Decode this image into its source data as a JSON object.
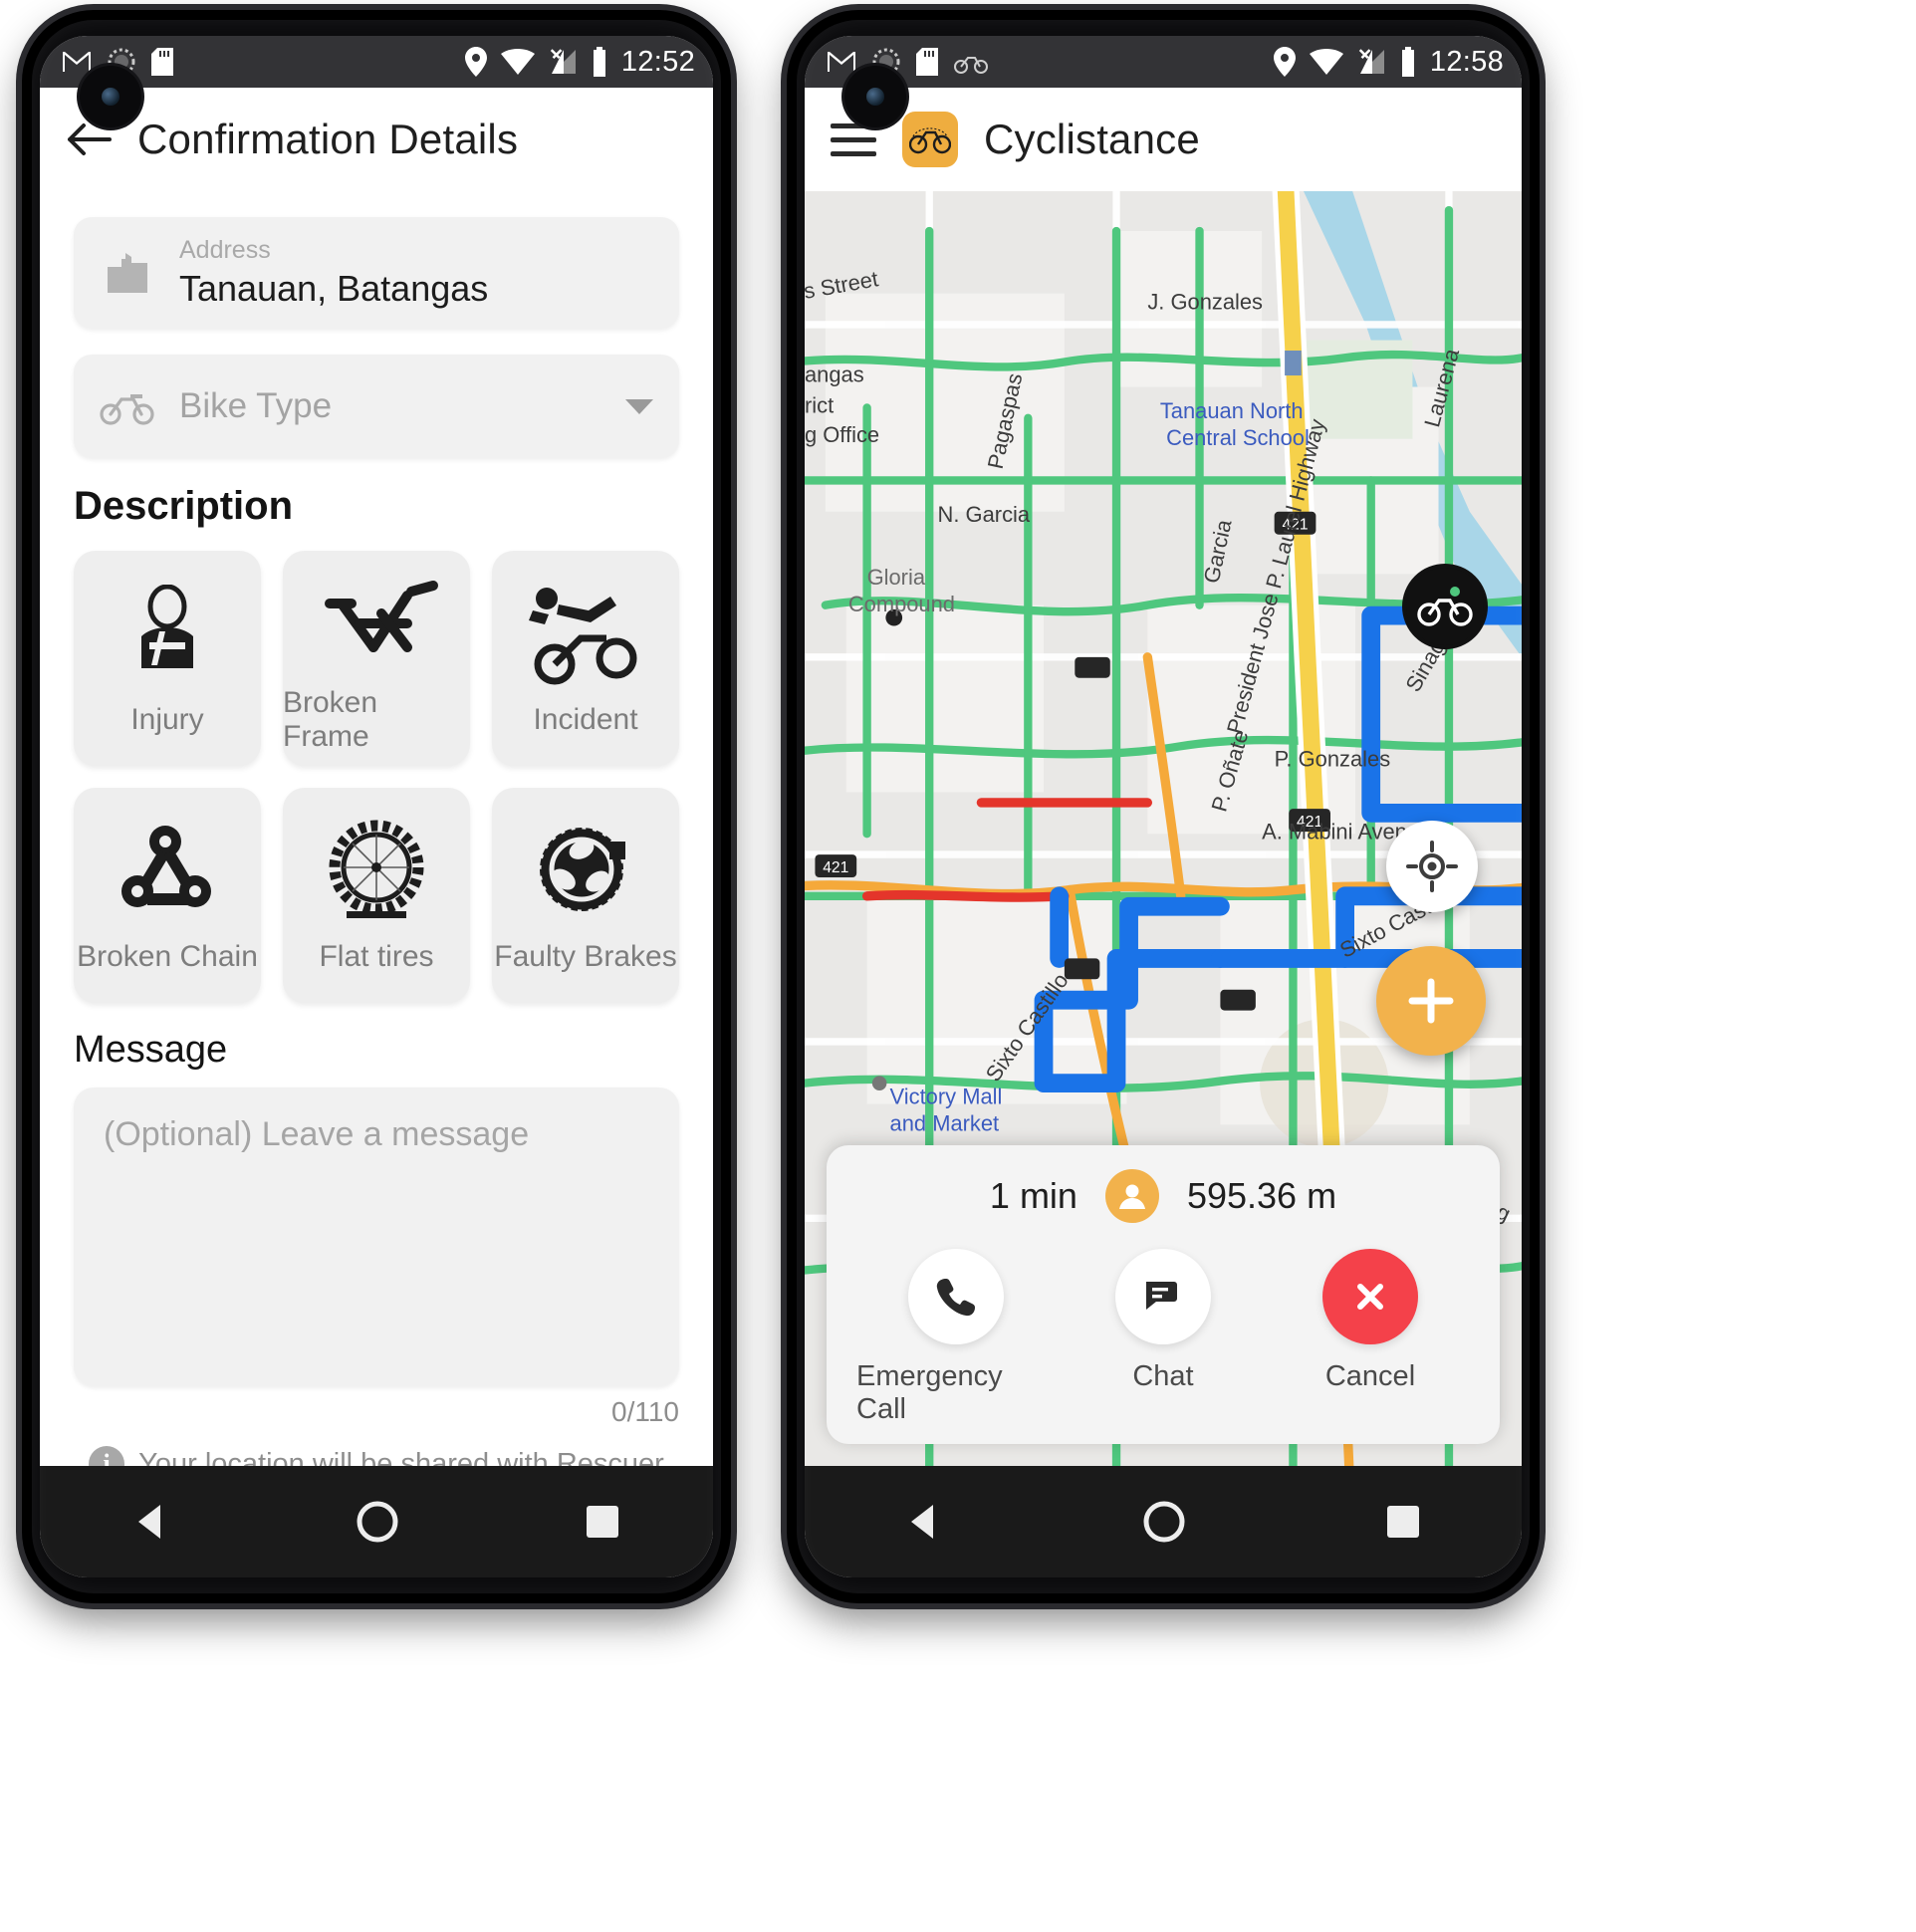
{
  "left_phone": {
    "status_bar": {
      "time": "12:52",
      "icons": [
        "gmail-icon",
        "sync-circle-icon",
        "sd-card-icon"
      ],
      "right_icons": [
        "location-pin-icon",
        "wifi-icon",
        "cell-signal-off-icon",
        "battery-icon"
      ]
    },
    "app_bar": {
      "back_label": "back-arrow",
      "title": "Confirmation Details"
    },
    "address_field": {
      "icon": "building-icon",
      "label": "Address",
      "value": "Tanauan, Batangas"
    },
    "bike_type_field": {
      "icon": "bicycle-icon",
      "placeholder": "Bike Type",
      "caret": "chevron-down-icon"
    },
    "description": {
      "title": "Description",
      "cards": [
        {
          "label": "Injury",
          "icon": "person-injured-icon"
        },
        {
          "label": "Broken Frame",
          "icon": "broken-bike-frame-icon"
        },
        {
          "label": "Incident",
          "icon": "bike-crash-icon"
        },
        {
          "label": "Broken Chain",
          "icon": "bike-chain-icon"
        },
        {
          "label": "Flat tires",
          "icon": "flat-tire-icon"
        },
        {
          "label": "Faulty Brakes",
          "icon": "brake-disc-icon"
        }
      ]
    },
    "message": {
      "title": "Message",
      "placeholder": "(Optional) Leave a message",
      "counter": "0/110"
    },
    "notice": {
      "icon": "info-icon",
      "text": "Your location will be shared with Rescuer"
    },
    "nav_bar": [
      "back-triangle-icon",
      "home-circle-icon",
      "recents-square-icon"
    ]
  },
  "right_phone": {
    "status_bar": {
      "time": "12:58",
      "icons": [
        "gmail-icon",
        "sync-circle-icon",
        "sd-card-icon",
        "bicycle-icon"
      ],
      "right_icons": [
        "location-pin-icon",
        "wifi-icon",
        "cell-signal-off-icon",
        "battery-icon"
      ]
    },
    "app_bar": {
      "menu": "hamburger-menu-icon",
      "logo": "cyclistance-bike-logo",
      "title": "Cyclistance"
    },
    "map": {
      "labels": [
        "s Street",
        "J. Gonzales",
        "angas",
        "rict",
        "g Office",
        "Tanauan North",
        "Central School",
        "Pagaspas",
        "Laurena",
        "N. Garcia",
        "Garcia",
        "Gloria",
        "Compound",
        "President Jose P. Laurel Highway",
        "P. Oñate",
        "P. Gonzales",
        "A. Mabini Avenue",
        "Sixto Castillo",
        "Victory Mall",
        "and Market",
        "P. Carandang"
      ],
      "shields": [
        "421",
        "421",
        "421"
      ],
      "route_color": "#1a73e8",
      "traffic_colors": {
        "good": "#4fc77e",
        "slow": "#f5a93a",
        "heavy": "#e4352b"
      }
    },
    "fabs": [
      {
        "name": "my-location-fab",
        "icon": "crosshair-icon"
      },
      {
        "name": "add-fab",
        "icon": "plus-icon"
      }
    ],
    "rider_marker": {
      "icon": "cyclist-marker-icon"
    },
    "bottom_sheet": {
      "eta": "1 min",
      "avatar": "user-avatar-icon",
      "distance": "595.36 m",
      "actions": [
        {
          "label": "Emergency Call",
          "icon": "phone-icon",
          "style": "light"
        },
        {
          "label": "Chat",
          "icon": "chat-icon",
          "style": "light"
        },
        {
          "label": "Cancel",
          "icon": "close-icon",
          "style": "danger"
        }
      ]
    },
    "nav_bar": [
      "back-triangle-icon",
      "home-circle-icon",
      "recents-square-icon"
    ]
  },
  "theme": {
    "accent": "#efad3f",
    "danger": "#f4414a",
    "route": "#1a73e8",
    "status_bar_bg": "#333336",
    "nav_bar_bg": "#1a1a1a"
  }
}
